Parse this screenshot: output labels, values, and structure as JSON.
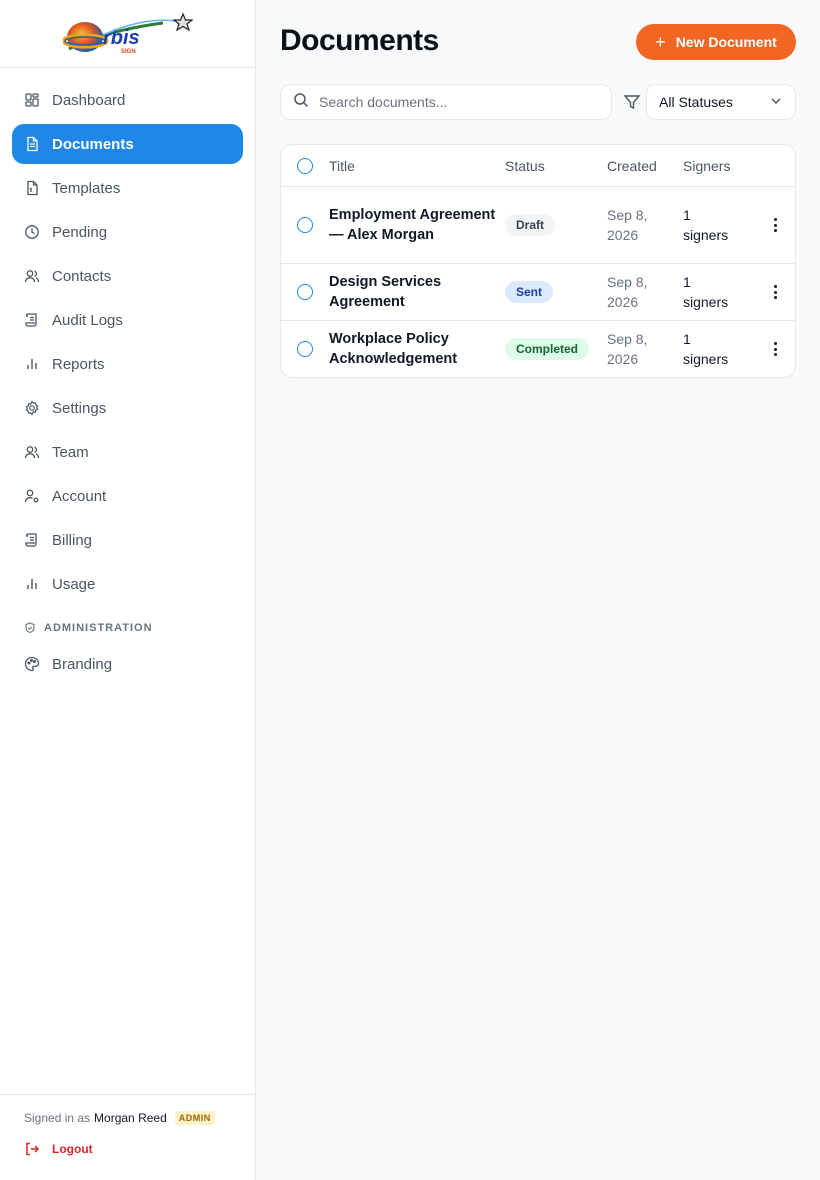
{
  "brand": {
    "logo_text": "rbis",
    "logo_sub": "SIGN"
  },
  "sidebar": {
    "items": [
      {
        "label": "Dashboard",
        "icon": "dashboard-icon"
      },
      {
        "label": "Documents",
        "icon": "document-icon",
        "active": true
      },
      {
        "label": "Templates",
        "icon": "template-icon"
      },
      {
        "label": "Pending",
        "icon": "clock-icon"
      },
      {
        "label": "Contacts",
        "icon": "users-icon"
      },
      {
        "label": "Audit Logs",
        "icon": "scroll-icon"
      },
      {
        "label": "Reports",
        "icon": "bar-chart-icon"
      },
      {
        "label": "Settings",
        "icon": "gear-icon"
      },
      {
        "label": "Team",
        "icon": "users-icon"
      },
      {
        "label": "Account",
        "icon": "user-cog-icon"
      },
      {
        "label": "Billing",
        "icon": "scroll-icon"
      },
      {
        "label": "Usage",
        "icon": "bar-chart-icon"
      }
    ],
    "admin_section_label": "ADMINISTRATION",
    "admin_items": [
      {
        "label": "Branding",
        "icon": "palette-icon"
      }
    ],
    "footer": {
      "signed_in_prefix": "Signed in as",
      "user_name": "Morgan Reed",
      "role_badge": "ADMIN",
      "logout_label": "Logout"
    }
  },
  "header": {
    "title": "Documents",
    "new_button_label": "New Document"
  },
  "filters": {
    "search_placeholder": "Search documents...",
    "status_selected": "All Statuses"
  },
  "table": {
    "columns": [
      "Title",
      "Status",
      "Created",
      "Signers"
    ],
    "rows": [
      {
        "title": "Employment Agreement — Alex Morgan",
        "status": "Draft",
        "created_line1": "Sep 8,",
        "created_line2": "2026",
        "signers_line1": "1",
        "signers_line2": "signers"
      },
      {
        "title": "Design Services Agreement",
        "status": "Sent",
        "created_line1": "Sep 8,",
        "created_line2": "2026",
        "signers_line1": "1",
        "signers_line2": "signers"
      },
      {
        "title": "Workplace Policy Acknowledgement",
        "status": "Completed",
        "created_line1": "Sep 8,",
        "created_line2": "2026",
        "signers_line1": "1",
        "signers_line2": "signers"
      }
    ]
  },
  "colors": {
    "accent_blue": "#1f87e5",
    "accent_orange": "#f26522",
    "danger": "#dc2626"
  }
}
